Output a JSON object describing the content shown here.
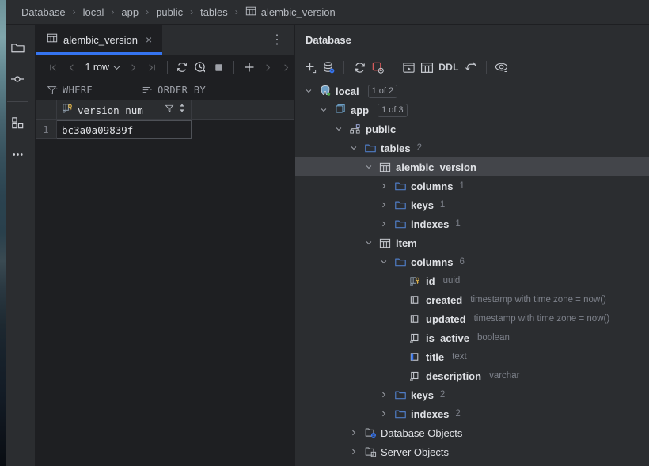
{
  "breadcrumb": {
    "items": [
      {
        "label": "Database",
        "icon": ""
      },
      {
        "label": "local",
        "icon": ""
      },
      {
        "label": "app",
        "icon": ""
      },
      {
        "label": "public",
        "icon": ""
      },
      {
        "label": "tables",
        "icon": ""
      },
      {
        "label": "alembic_version",
        "icon": "table-icon"
      }
    ],
    "separator": "›"
  },
  "rail": {
    "items": [
      {
        "name": "project-folder-icon",
        "tooltip": "Project"
      },
      {
        "name": "commit-icon",
        "tooltip": "Commit"
      },
      {
        "name": "plugins-icon",
        "tooltip": "Services"
      },
      {
        "name": "more-tool-windows-icon",
        "tooltip": "More"
      }
    ]
  },
  "editor": {
    "tab": {
      "label": "alembic_version",
      "icon": "table-icon",
      "close": "×",
      "menu": "⋮"
    },
    "toolbar": {
      "first_page": "⏮",
      "prev_page": "‹",
      "row_count": "1 row",
      "chevron": "⌄",
      "next_page": "›",
      "last_page": "⏭",
      "refresh": "refresh-icon",
      "history": "history-clock-icon",
      "stop": "stop-icon",
      "add_row": "+",
      "expand_one": "›",
      "expand_all": "›"
    },
    "filters": {
      "where_label": "WHERE",
      "order_label": "ORDER BY"
    },
    "grid": {
      "column": {
        "name": "version_num",
        "icon": "primary-key-icon",
        "filter_icon": "filter-icon",
        "sort_icon": "sort-icon"
      },
      "rows": [
        {
          "num": "1",
          "version_num": "bc3a0a09839f"
        }
      ]
    }
  },
  "database": {
    "title": "Database",
    "toolbar": {
      "new": "+",
      "data_source": "data-source-icon",
      "refresh": "refresh-icon",
      "disconnect": "disconnect-icon",
      "console": "console-icon",
      "table_editor": "table-editor-icon",
      "ddl": "DDL",
      "jump_to": "jump-to-icon",
      "preview": "eye-icon"
    },
    "tree": [
      {
        "label": "local",
        "icon": "postgres-icon",
        "badge": "1 of 2",
        "depth": 0,
        "expanded": true,
        "selected": false,
        "bold": true
      },
      {
        "label": "app",
        "icon": "database-icon",
        "badge": "1 of 3",
        "depth": 1,
        "expanded": true,
        "selected": false,
        "bold": true
      },
      {
        "label": "public",
        "icon": "schema-icon",
        "depth": 2,
        "expanded": true,
        "selected": false,
        "bold": true
      },
      {
        "label": "tables",
        "icon": "folder-icon",
        "count": "2",
        "depth": 3,
        "expanded": true,
        "selected": false,
        "bold": true
      },
      {
        "label": "alembic_version",
        "icon": "table-icon",
        "depth": 4,
        "expanded": true,
        "selected": true,
        "bold": true
      },
      {
        "label": "columns",
        "icon": "folder-icon",
        "count": "1",
        "depth": 5,
        "expanded": false,
        "selected": false,
        "bold": true
      },
      {
        "label": "keys",
        "icon": "folder-icon",
        "count": "1",
        "depth": 5,
        "expanded": false,
        "selected": false,
        "bold": true
      },
      {
        "label": "indexes",
        "icon": "folder-icon",
        "count": "1",
        "depth": 5,
        "expanded": false,
        "selected": false,
        "bold": true
      },
      {
        "label": "item",
        "icon": "table-icon",
        "depth": 4,
        "expanded": true,
        "selected": false,
        "bold": true
      },
      {
        "label": "columns",
        "icon": "folder-icon",
        "count": "6",
        "depth": 5,
        "expanded": true,
        "selected": false,
        "bold": true
      },
      {
        "label": "id",
        "icon": "primary-key-icon",
        "type": "uuid",
        "depth": 6,
        "leaf": true,
        "selected": false,
        "bold": true
      },
      {
        "label": "created",
        "icon": "column-icon",
        "type": "timestamp with time zone = now()",
        "depth": 6,
        "leaf": true,
        "selected": false,
        "bold": true
      },
      {
        "label": "updated",
        "icon": "column-icon",
        "type": "timestamp with time zone = now()",
        "depth": 6,
        "leaf": true,
        "selected": false,
        "bold": true
      },
      {
        "label": "is_active",
        "icon": "nullable-column-icon",
        "type": "boolean",
        "depth": 6,
        "leaf": true,
        "selected": false,
        "bold": true
      },
      {
        "label": "title",
        "icon": "indexed-column-icon",
        "type": "text",
        "depth": 6,
        "leaf": true,
        "selected": false,
        "bold": true
      },
      {
        "label": "description",
        "icon": "nullable-column-icon",
        "type": "varchar",
        "depth": 6,
        "leaf": true,
        "selected": false,
        "bold": true
      },
      {
        "label": "keys",
        "icon": "folder-icon",
        "count": "2",
        "depth": 5,
        "expanded": false,
        "selected": false,
        "bold": true
      },
      {
        "label": "indexes",
        "icon": "folder-icon",
        "count": "2",
        "depth": 5,
        "expanded": false,
        "selected": false,
        "bold": true
      },
      {
        "label": "Database Objects",
        "icon": "db-objects-icon",
        "depth": 3,
        "expanded": false,
        "selected": false,
        "bold": false
      },
      {
        "label": "Server Objects",
        "icon": "server-objects-icon",
        "depth": 3,
        "expanded": false,
        "selected": false,
        "bold": false
      }
    ]
  },
  "colors": {
    "accent": "#3574f0",
    "panel": "#2b2d30",
    "editor": "#1e1f22",
    "selection": "#43454a",
    "folder": "#4f7cc4",
    "danger": "#db5c5c"
  }
}
